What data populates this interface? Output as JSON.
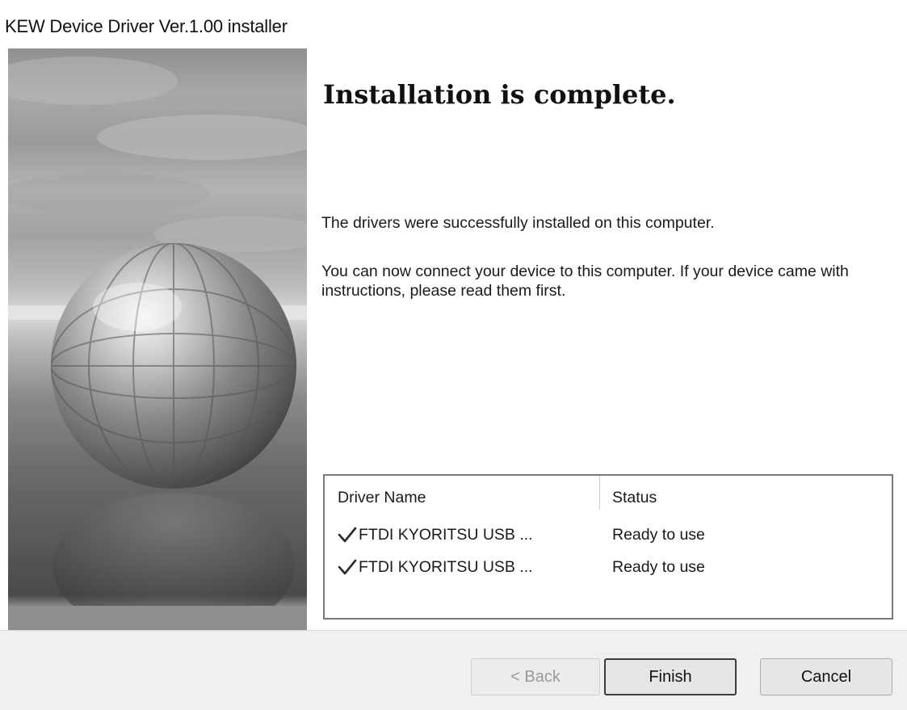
{
  "window": {
    "title": "KEW Device Driver Ver.1.00 installer"
  },
  "main": {
    "heading": "Installation is complete.",
    "paragraph_1": "The drivers were successfully installed on this computer.",
    "paragraph_2": "You can now connect your device to this computer. If your device came with instructions, please read them first."
  },
  "driver_list": {
    "columns": {
      "name": "Driver Name",
      "status": "Status"
    },
    "rows": [
      {
        "icon": "checkmark-icon",
        "name": "FTDI KYORITSU USB ...",
        "status": "Ready to use"
      },
      {
        "icon": "checkmark-icon",
        "name": "FTDI KYORITSU USB ...",
        "status": "Ready to use"
      }
    ]
  },
  "buttons": {
    "back": "< Back",
    "finish": "Finish",
    "cancel": "Cancel"
  },
  "colors": {
    "panel_gray": "#8f8f8f",
    "footer_bg": "#f0f0f0",
    "disabled_text": "#9a9a9a"
  }
}
